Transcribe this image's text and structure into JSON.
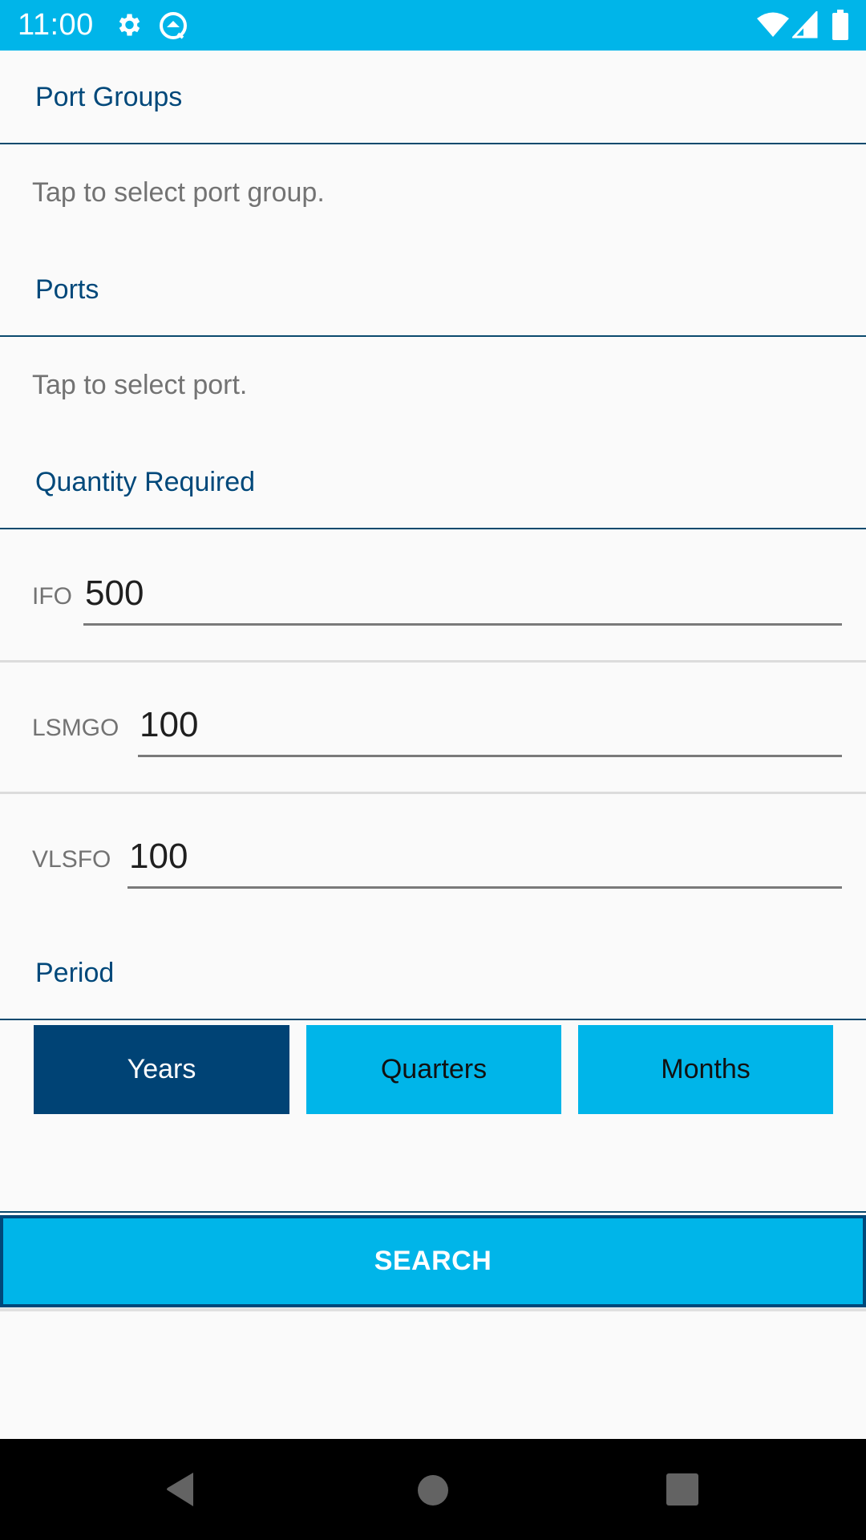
{
  "status_bar": {
    "time": "11:00",
    "icons": [
      "gear-icon",
      "q-badge-icon",
      "wifi-icon",
      "signal-icon",
      "battery-icon"
    ],
    "background": "#00b5e9"
  },
  "sections": {
    "port_groups": {
      "title": "Port Groups",
      "placeholder": "Tap to select port group."
    },
    "ports": {
      "title": "Ports",
      "placeholder": "Tap to select port."
    },
    "quantity": {
      "title": "Quantity Required",
      "fields": [
        {
          "label": "IFO",
          "value": "500"
        },
        {
          "label": "LSMGO",
          "value": "100"
        },
        {
          "label": "VLSFO",
          "value": "100"
        }
      ]
    },
    "period": {
      "title": "Period",
      "options": [
        {
          "label": "Years",
          "selected": true
        },
        {
          "label": "Quarters",
          "selected": false
        },
        {
          "label": "Months",
          "selected": false
        }
      ],
      "selected_value": "Years"
    }
  },
  "search_button": {
    "label": "SEARCH"
  },
  "colors": {
    "accent": "#00b5e9",
    "primary_dark": "#004375",
    "title_text": "#00487a",
    "placeholder_text": "#737373"
  },
  "nav_bar": {
    "icons": [
      "back-icon",
      "home-icon",
      "recents-icon"
    ]
  }
}
